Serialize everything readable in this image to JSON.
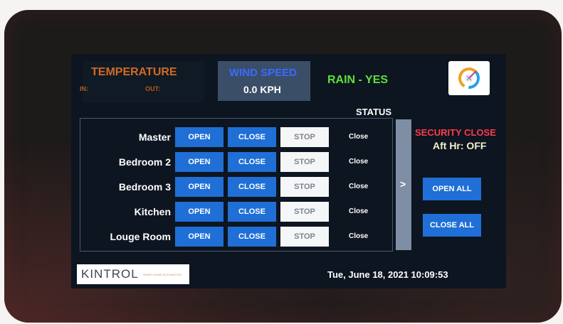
{
  "weather": {
    "temperature_title": "TEMPERATURE",
    "temp_in_label": "IN:",
    "temp_out_label": "OUT:",
    "wind_title": "WIND SPEED",
    "wind_value": "0.0 KPH",
    "rain": "RAIN - YES"
  },
  "table": {
    "status_header": "STATUS",
    "rows": [
      {
        "label": "Master",
        "open": "OPEN",
        "close": "CLOSE",
        "stop": "STOP",
        "status": "Close"
      },
      {
        "label": "Bedroom 2",
        "open": "OPEN",
        "close": "CLOSE",
        "stop": "STOP",
        "status": "Close"
      },
      {
        "label": "Bedroom 3",
        "open": "OPEN",
        "close": "CLOSE",
        "stop": "STOP",
        "status": "Close"
      },
      {
        "label": "Kitchen",
        "open": "OPEN",
        "close": "CLOSE",
        "stop": "STOP",
        "status": "Close"
      },
      {
        "label": "Louge Room",
        "open": "OPEN",
        "close": "CLOSE",
        "stop": "STOP",
        "status": "Close"
      }
    ],
    "scroll_arrow": ">"
  },
  "sidebar": {
    "security_close": "SECURITY CLOSE",
    "after_hours": "Aft Hr: OFF",
    "open_all": "OPEN ALL",
    "close_all": "CLOSE ALL"
  },
  "footer": {
    "brand": "KINTROL",
    "brand_sub": "SMART HOME AUTOMATION",
    "datetime": "Tue, June 18, 2021  10:09:53"
  },
  "icons": {
    "settings_logo": "gauge-logo-icon"
  },
  "colors": {
    "button_blue": "#1f6fd6",
    "temperature_orange": "#d26a22",
    "wind_blue": "#3a6bff",
    "rain_green": "#5de03a",
    "security_red": "#ff3a4a"
  }
}
